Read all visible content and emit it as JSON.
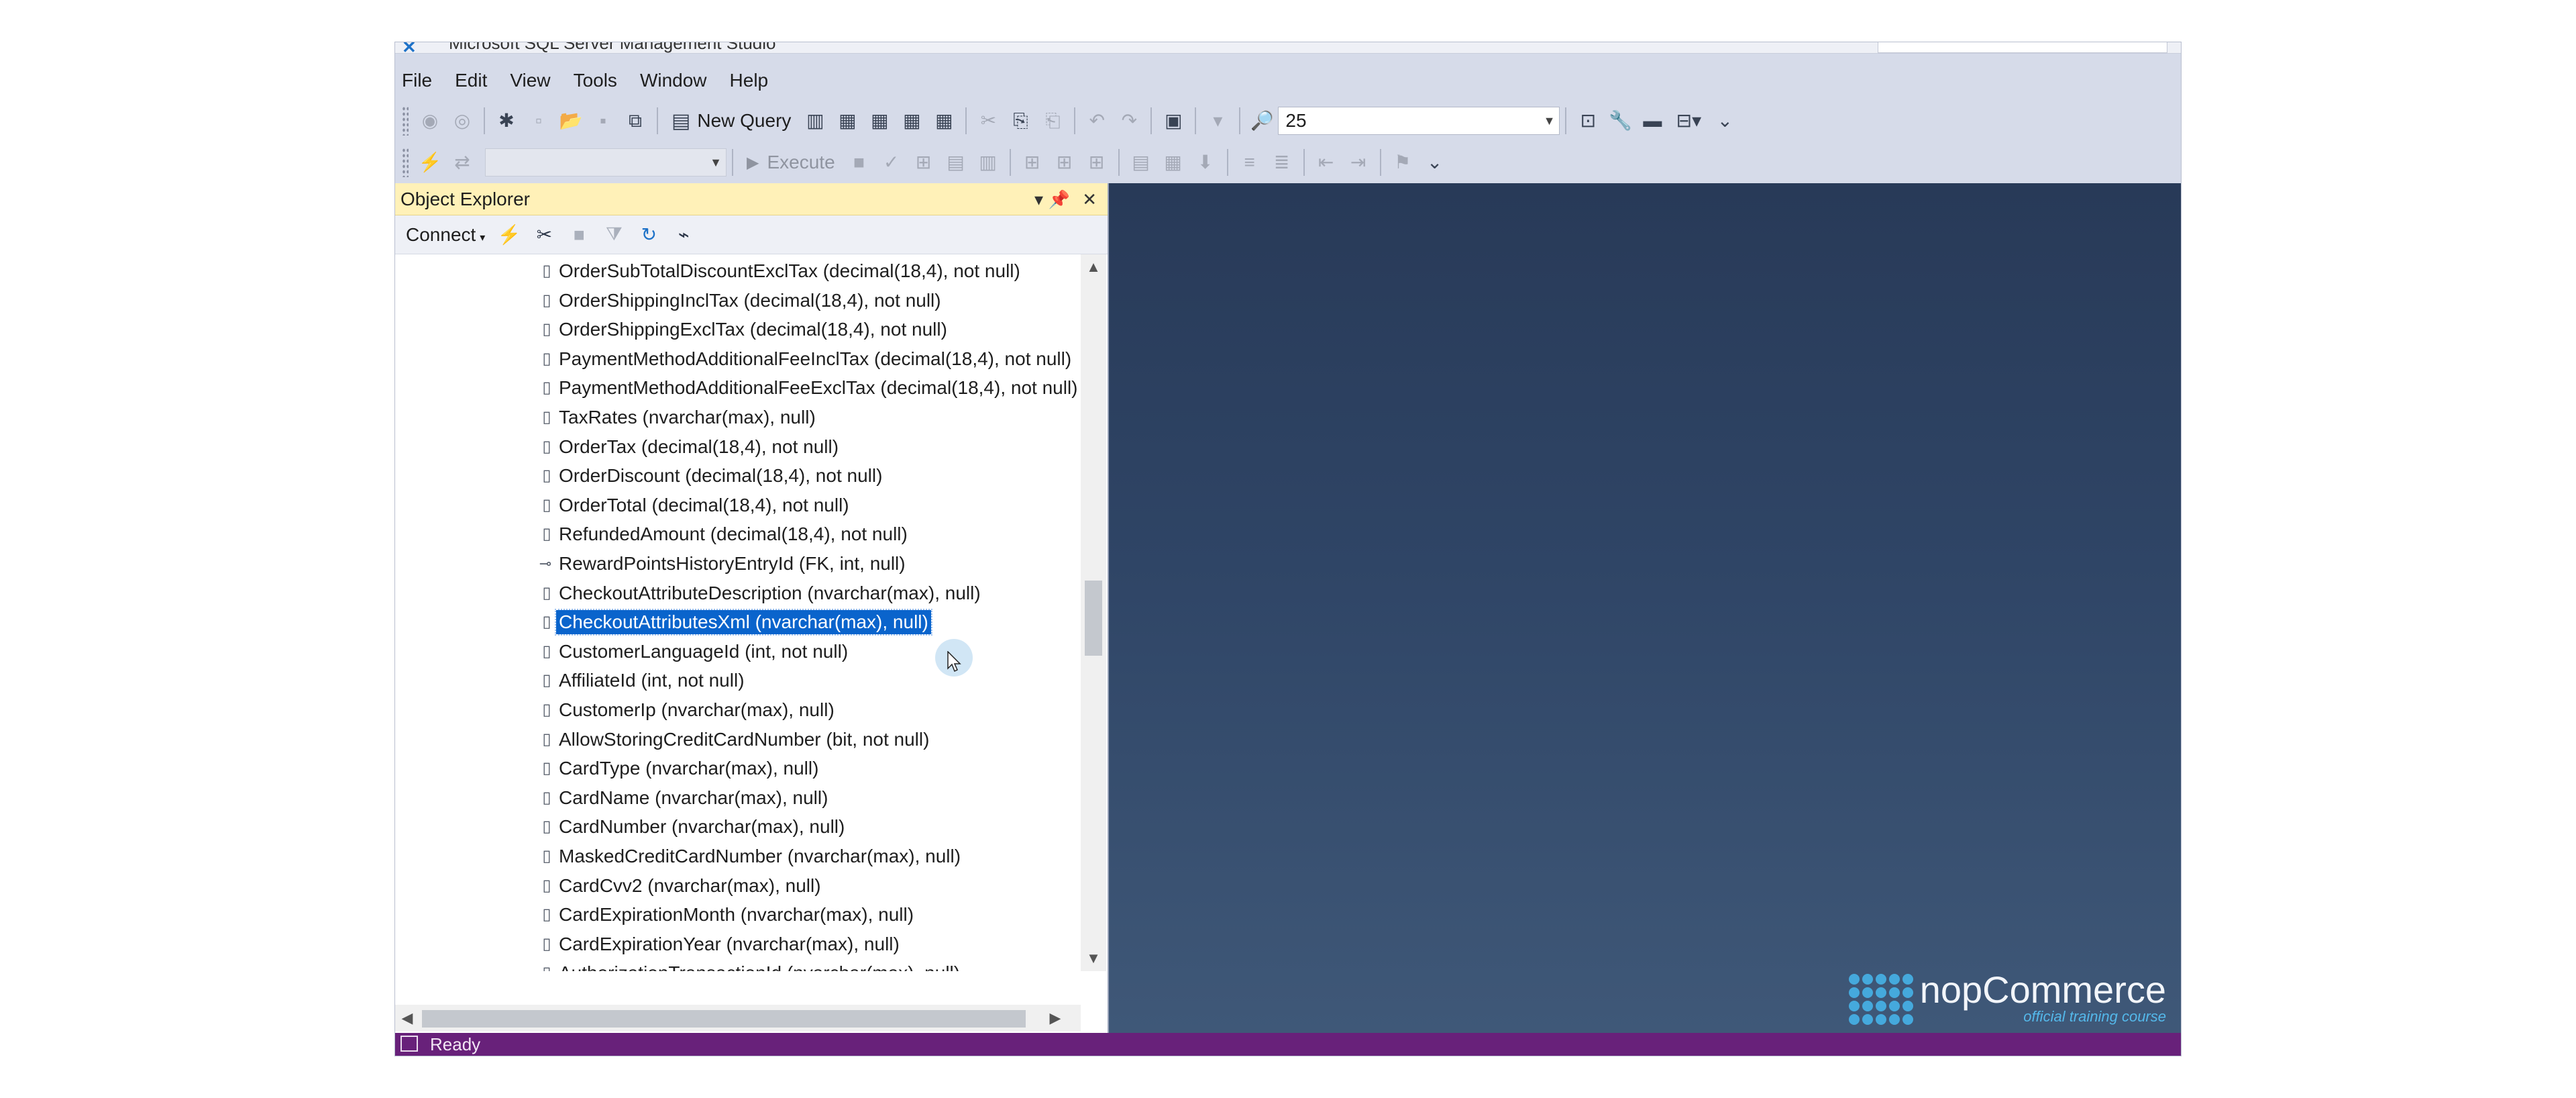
{
  "window": {
    "title": "Microsoft SQL Server Management Studio"
  },
  "menu": [
    "File",
    "Edit",
    "View",
    "Tools",
    "Window",
    "Help"
  ],
  "toolbar": {
    "new_query": "New Query",
    "combo_value": "25",
    "execute": "Execute"
  },
  "object_explorer": {
    "title": "Object Explorer",
    "connect": "Connect",
    "columns": [
      {
        "text": "OrderSubTotalDiscountExclTax (decimal(18,4), not null)",
        "icon": "column-icon"
      },
      {
        "text": "OrderShippingInclTax (decimal(18,4), not null)",
        "icon": "column-icon"
      },
      {
        "text": "OrderShippingExclTax (decimal(18,4), not null)",
        "icon": "column-icon"
      },
      {
        "text": "PaymentMethodAdditionalFeeInclTax (decimal(18,4), not null)",
        "icon": "column-icon"
      },
      {
        "text": "PaymentMethodAdditionalFeeExclTax (decimal(18,4), not null)",
        "icon": "column-icon"
      },
      {
        "text": "TaxRates (nvarchar(max), null)",
        "icon": "column-icon"
      },
      {
        "text": "OrderTax (decimal(18,4), not null)",
        "icon": "column-icon"
      },
      {
        "text": "OrderDiscount (decimal(18,4), not null)",
        "icon": "column-icon"
      },
      {
        "text": "OrderTotal (decimal(18,4), not null)",
        "icon": "column-icon"
      },
      {
        "text": "RefundedAmount (decimal(18,4), not null)",
        "icon": "column-icon"
      },
      {
        "text": "RewardPointsHistoryEntryId (FK, int, null)",
        "icon": "foreign-key-icon"
      },
      {
        "text": "CheckoutAttributeDescription (nvarchar(max), null)",
        "icon": "column-icon"
      },
      {
        "text": "CheckoutAttributesXml (nvarchar(max), null)",
        "icon": "column-icon",
        "selected": true
      },
      {
        "text": "CustomerLanguageId (int, not null)",
        "icon": "column-icon"
      },
      {
        "text": "AffiliateId (int, not null)",
        "icon": "column-icon"
      },
      {
        "text": "CustomerIp (nvarchar(max), null)",
        "icon": "column-icon"
      },
      {
        "text": "AllowStoringCreditCardNumber (bit, not null)",
        "icon": "column-icon"
      },
      {
        "text": "CardType (nvarchar(max), null)",
        "icon": "column-icon"
      },
      {
        "text": "CardName (nvarchar(max), null)",
        "icon": "column-icon"
      },
      {
        "text": "CardNumber (nvarchar(max), null)",
        "icon": "column-icon"
      },
      {
        "text": "MaskedCreditCardNumber (nvarchar(max), null)",
        "icon": "column-icon"
      },
      {
        "text": "CardCvv2 (nvarchar(max), null)",
        "icon": "column-icon"
      },
      {
        "text": "CardExpirationMonth (nvarchar(max), null)",
        "icon": "column-icon"
      },
      {
        "text": "CardExpirationYear (nvarchar(max), null)",
        "icon": "column-icon"
      },
      {
        "text": "AuthorizationTransactionId (nvarchar(max), null)",
        "icon": "column-icon"
      }
    ]
  },
  "branding": {
    "name": "nopCommerce",
    "tagline": "official training course"
  },
  "status": {
    "text": "Ready"
  },
  "colors": {
    "selection": "#0a64cc",
    "oe_header": "#fff1b8",
    "status_bar": "#68217a",
    "workspace": "#2f4566"
  }
}
